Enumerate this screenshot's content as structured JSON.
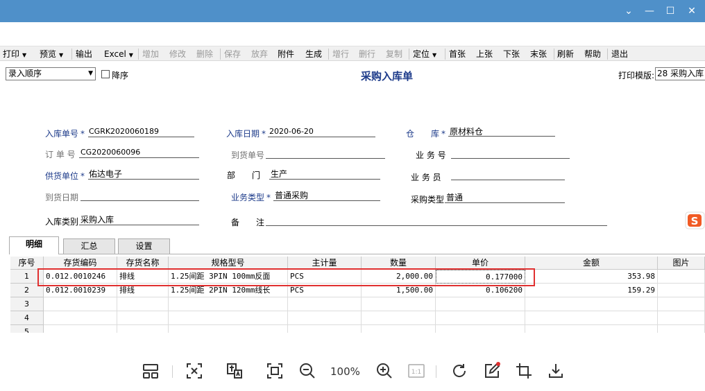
{
  "window": {
    "minimize_label": "—",
    "maximize_label": "☐",
    "close_label": "✕",
    "chevron_label": "⌄"
  },
  "toolbar": {
    "items": [
      {
        "label": "打印",
        "enabled": true,
        "dropdown": true
      },
      {
        "label": "预览",
        "enabled": true,
        "dropdown": true
      },
      {
        "label": "输出",
        "enabled": true
      },
      {
        "label": "Excel",
        "enabled": true,
        "dropdown": true
      },
      {
        "label": "增加",
        "enabled": false
      },
      {
        "label": "修改",
        "enabled": false
      },
      {
        "label": "删除",
        "enabled": false
      },
      {
        "label": "保存",
        "enabled": false
      },
      {
        "label": "放弃",
        "enabled": false
      },
      {
        "label": "附件",
        "enabled": true
      },
      {
        "label": "生成",
        "enabled": true
      },
      {
        "label": "增行",
        "enabled": false
      },
      {
        "label": "删行",
        "enabled": false
      },
      {
        "label": "复制",
        "enabled": false
      },
      {
        "label": "定位",
        "enabled": true,
        "dropdown": true
      },
      {
        "label": "首张",
        "enabled": true
      },
      {
        "label": "上张",
        "enabled": true
      },
      {
        "label": "下张",
        "enabled": true
      },
      {
        "label": "末张",
        "enabled": true
      },
      {
        "label": "刷新",
        "enabled": true
      },
      {
        "label": "帮助",
        "enabled": true
      },
      {
        "label": "退出",
        "enabled": true
      }
    ]
  },
  "header": {
    "sort_select": "录入顺序",
    "desc_label": "降序",
    "title": "采购入库单",
    "print_template_label": "打印模版:",
    "print_template_value": "28 采购入库"
  },
  "form": {
    "receipt_no_label": "入库单号",
    "receipt_no": "CGRK2020060189",
    "receipt_date_label": "入库日期",
    "receipt_date": "2020-06-20",
    "warehouse_label": "仓　　库",
    "warehouse": "原材料仓",
    "order_no_label": "订 单 号",
    "order_no": "CG2020060096",
    "arrival_no_label": "到货单号",
    "arrival_no": "",
    "business_no_label": "业 务 号",
    "business_no": "",
    "supplier_label": "供货单位",
    "supplier": "佑达电子",
    "dept_label": "部　　门",
    "dept": "生产",
    "salesman_label": "业 务 员",
    "salesman": "",
    "arrival_date_label": "到货日期",
    "arrival_date": "",
    "biz_type_label": "业务类型",
    "biz_type": "普通采购",
    "purchase_type_label": "采购类型",
    "purchase_type": "普通",
    "inbound_type_label": "入库类别",
    "inbound_type": "采购入库",
    "remark_label": "备　　注",
    "remark": ""
  },
  "tabs": [
    {
      "label": "明细"
    },
    {
      "label": "汇总"
    },
    {
      "label": "设置"
    }
  ],
  "grid": {
    "headers": [
      "序号",
      "存货编码",
      "存货名称",
      "规格型号",
      "主计量",
      "数量",
      "单价",
      "金额",
      "图片"
    ],
    "rows": [
      {
        "no": "1",
        "code": "0.012.0010246",
        "name": "排线",
        "spec": "1.25间距 3PIN 100mm反面",
        "unit": "PCS",
        "qty": "2,000.00",
        "price": "0.177000",
        "amount": "353.98",
        "pic": ""
      },
      {
        "no": "2",
        "code": "0.012.0010239",
        "name": "排线",
        "spec": "1.25间距 2PIN 120mm线长",
        "unit": "PCS",
        "qty": "1,500.00",
        "price": "0.106200",
        "amount": "159.29",
        "pic": ""
      },
      {
        "no": "3",
        "code": "",
        "name": "",
        "spec": "",
        "unit": "",
        "qty": "",
        "price": "",
        "amount": "",
        "pic": ""
      },
      {
        "no": "4",
        "code": "",
        "name": "",
        "spec": "",
        "unit": "",
        "qty": "",
        "price": "",
        "amount": "",
        "pic": ""
      },
      {
        "no": "5",
        "code": "",
        "name": "",
        "spec": "",
        "unit": "",
        "qty": "",
        "price": "",
        "amount": "",
        "pic": ""
      }
    ]
  },
  "viewer": {
    "zoom": "100%",
    "one_to_one": "1:1"
  },
  "colors": {
    "titlebar": "#4f90c9",
    "title_text": "#1d3b8a",
    "highlight": "#e03030"
  }
}
